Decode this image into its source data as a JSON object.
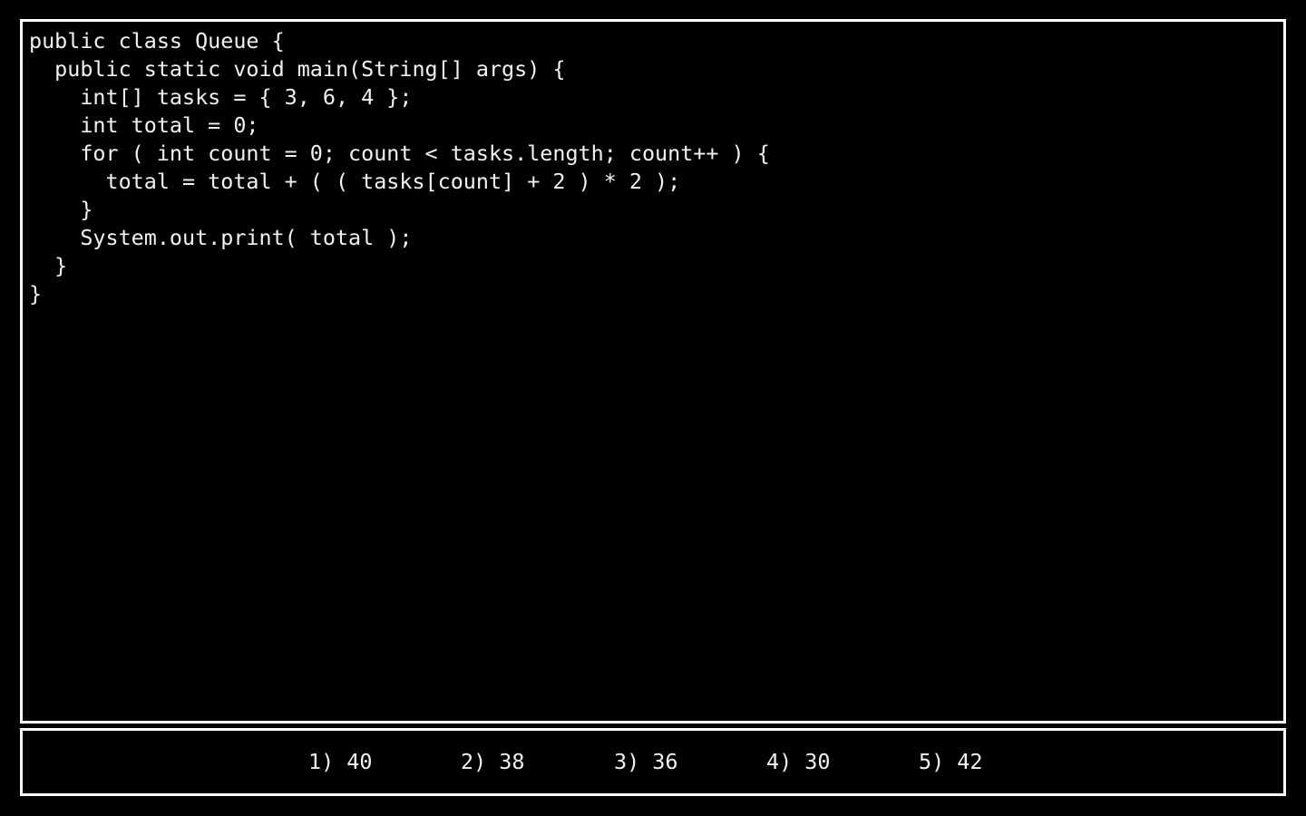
{
  "theme": {
    "background_color": "#000000",
    "text_color": "#f2f2f2",
    "border_color": "#ffffff"
  },
  "code_panel": {
    "language": "java",
    "lines": [
      "public class Queue {",
      "  public static void main(String[] args) {",
      "    int[] tasks = { 3, 6, 4 };",
      "    int total = 0;",
      "    for ( int count = 0; count < tasks.length; count++ ) {",
      "      total = total + ( ( tasks[count] + 2 ) * 2 );",
      "    }",
      "    System.out.print( total );",
      "  }",
      "}"
    ],
    "full_text": "public class Queue {\n  public static void main(String[] args) {\n    int[] tasks = { 3, 6, 4 };\n    int total = 0;\n    for ( int count = 0; count < tasks.length; count++ ) {\n      total = total + ( ( tasks[count] + 2 ) * 2 );\n    }\n    System.out.print( total );\n  }\n}"
  },
  "answer_panel": {
    "options": [
      {
        "number": "1)",
        "value": "40",
        "label": "1) 40"
      },
      {
        "number": "2)",
        "value": "38",
        "label": "2) 38"
      },
      {
        "number": "3)",
        "value": "36",
        "label": "3) 36"
      },
      {
        "number": "4)",
        "value": "30",
        "label": "4) 30"
      },
      {
        "number": "5)",
        "value": "42",
        "label": "5) 42"
      }
    ]
  }
}
